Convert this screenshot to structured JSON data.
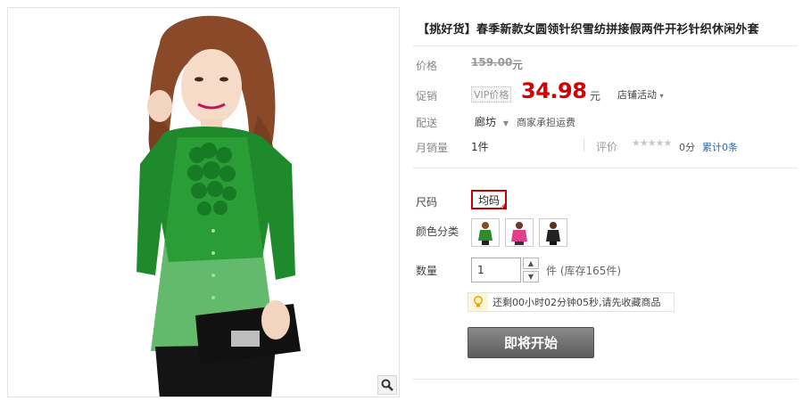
{
  "product": {
    "title": "【挑好货】春季新款女圆领针织雪纺拼接假两件开衫针织休闲外套"
  },
  "price": {
    "label": "价格",
    "original": "159.00",
    "unit": "元"
  },
  "promo": {
    "label": "促销",
    "vip_tag": "VIP价格",
    "price": "34.98",
    "unit": "元",
    "store_activity": "店铺活动"
  },
  "shipping": {
    "label": "配送",
    "location": "廊坊",
    "note": "商家承担运费"
  },
  "stats": {
    "sales_label": "月销量",
    "sales_value": "1件",
    "review_label": "评价",
    "stars": "★★★★★",
    "score": "0分",
    "review_count": "累计0条"
  },
  "size": {
    "label": "尺码",
    "options": [
      "均码"
    ],
    "selected": "均码"
  },
  "color": {
    "label": "颜色分类",
    "options": [
      {
        "name": "green",
        "swatch": "#2e8b2e"
      },
      {
        "name": "pink",
        "swatch": "#e0408a"
      },
      {
        "name": "black",
        "swatch": "#222222"
      }
    ]
  },
  "quantity": {
    "label": "数量",
    "value": "1",
    "unit_stock": "件 (库存165件)"
  },
  "tip": {
    "icon": "lightbulb-icon",
    "text": "还剩00小时02分钟05秒,请先收藏商品"
  },
  "action": {
    "start_label": "即将开始",
    "color": "#6e6e6e"
  },
  "colors": {
    "accent_red": "#d40000",
    "border_red": "#c40000",
    "link_blue": "#3366aa"
  },
  "gallery": {
    "zoom_icon": "magnifier-icon"
  }
}
